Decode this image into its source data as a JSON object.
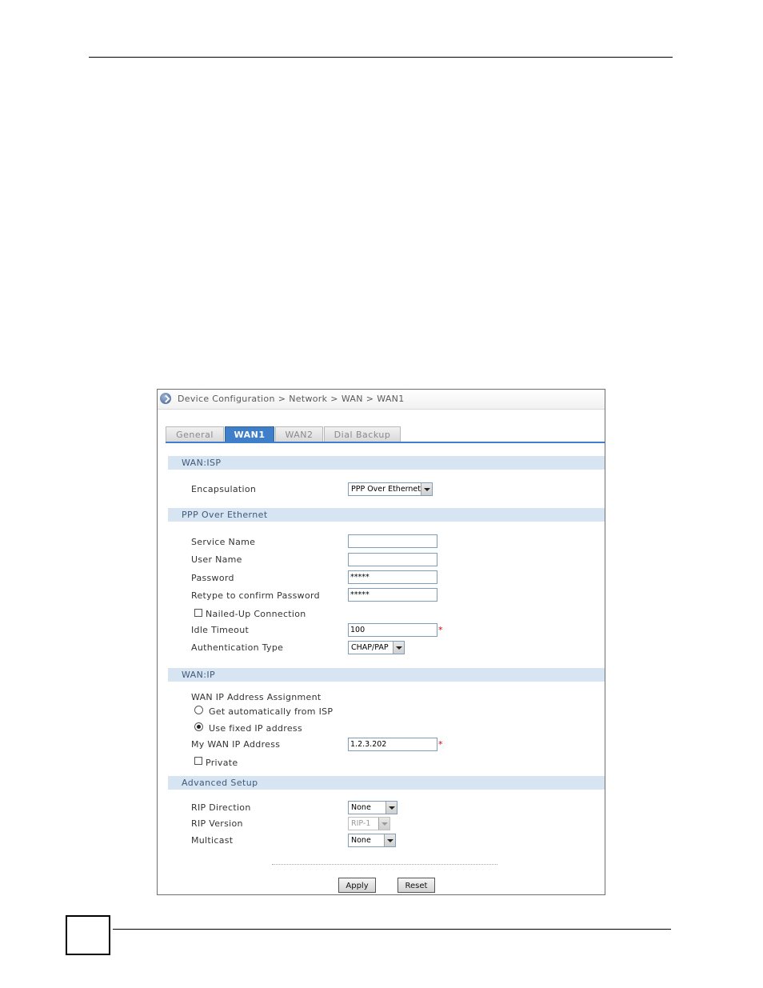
{
  "breadcrumb": {
    "root": "Device Configuration",
    "level2": "Network",
    "level3": "WAN",
    "current": "WAN1",
    "separator": ">"
  },
  "tabs": [
    {
      "label": "General",
      "active": false
    },
    {
      "label": "WAN1",
      "active": true
    },
    {
      "label": "WAN2",
      "active": false
    },
    {
      "label": "Dial Backup",
      "active": false
    }
  ],
  "sections": {
    "wan_isp": "WAN:ISP",
    "pppoe": "PPP Over Ethernet",
    "wan_ip": "WAN:IP",
    "advanced": "Advanced Setup"
  },
  "wan_isp": {
    "encapsulation_label": "Encapsulation",
    "encapsulation_value": "PPP Over Ethernet"
  },
  "pppoe": {
    "service_name_label": "Service Name",
    "service_name_value": "",
    "user_name_label": "User Name",
    "user_name_value": "",
    "password_label": "Password",
    "password_value": "*****",
    "retype_label": "Retype to confirm Password",
    "retype_value": "*****",
    "nailed_up_label": "Nailed-Up Connection",
    "nailed_up_checked": false,
    "idle_timeout_label": "Idle Timeout",
    "idle_timeout_value": "100",
    "auth_type_label": "Authentication Type",
    "auth_type_value": "CHAP/PAP",
    "required_mark": "*"
  },
  "wan_ip": {
    "assignment_label": "WAN IP Address Assignment",
    "option_auto": "Get automatically from ISP",
    "option_fixed": "Use fixed IP address",
    "selected_option": "fixed",
    "my_ip_label": "My WAN IP Address",
    "my_ip_value": "1.2.3.202",
    "private_label": "Private",
    "private_checked": false,
    "required_mark": "*"
  },
  "advanced": {
    "rip_direction_label": "RIP Direction",
    "rip_direction_value": "None",
    "rip_version_label": "RIP Version",
    "rip_version_value": "RIP-1",
    "multicast_label": "Multicast",
    "multicast_value": "None"
  },
  "buttons": {
    "apply": "Apply",
    "reset": "Reset"
  },
  "colors": {
    "tab_active": "#3f7fca",
    "section_band": "#d7e4f2",
    "required": "#dd0000"
  }
}
